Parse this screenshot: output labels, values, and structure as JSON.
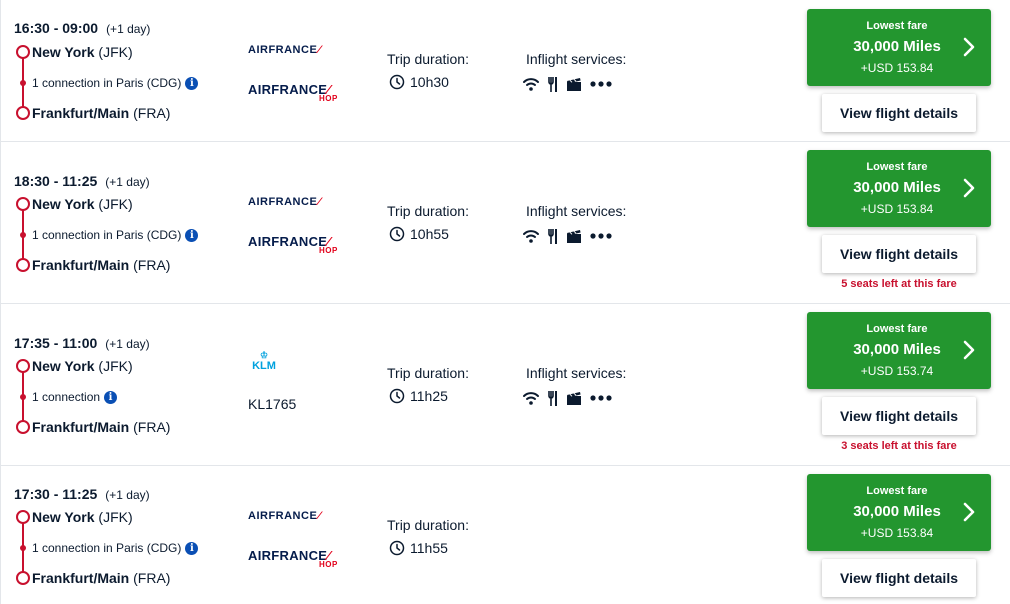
{
  "flights": [
    {
      "times": "16:30 - 09:00",
      "plus_day": "(+1 day)",
      "origin_city": "New York",
      "origin_code": "(JFK)",
      "connection": "1 connection in Paris (CDG)",
      "dest_city": "Frankfurt/Main",
      "dest_code": "(FRA)",
      "airline_primary": "AIRFRANCE",
      "airline_secondary": "AIRFRANCE",
      "airline_secondary_sub": "HOP",
      "duration_label": "Trip duration:",
      "duration": "10h30",
      "services_label": "Inflight services:",
      "fare_label": "Lowest fare",
      "fare_miles": "30,000 Miles",
      "fare_usd": "+USD 153.84",
      "details_label": "View flight details"
    },
    {
      "times": "18:30 - 11:25",
      "plus_day": "(+1 day)",
      "origin_city": "New York",
      "origin_code": "(JFK)",
      "connection": "1 connection in Paris (CDG)",
      "dest_city": "Frankfurt/Main",
      "dest_code": "(FRA)",
      "airline_primary": "AIRFRANCE",
      "airline_secondary": "AIRFRANCE",
      "airline_secondary_sub": "HOP",
      "duration_label": "Trip duration:",
      "duration": "10h55",
      "services_label": "Inflight services:",
      "fare_label": "Lowest fare",
      "fare_miles": "30,000 Miles",
      "fare_usd": "+USD 153.84",
      "details_label": "View flight details",
      "seats_left": "5 seats left at this fare"
    },
    {
      "times": "17:35 - 11:00",
      "plus_day": "(+1 day)",
      "origin_city": "New York",
      "origin_code": "(JFK)",
      "connection": "1 connection",
      "dest_city": "Frankfurt/Main",
      "dest_code": "(FRA)",
      "airline_primary": "KLM",
      "flight_number": "KL1765",
      "duration_label": "Trip duration:",
      "duration": "11h25",
      "services_label": "Inflight services:",
      "fare_label": "Lowest fare",
      "fare_miles": "30,000 Miles",
      "fare_usd": "+USD 153.74",
      "details_label": "View flight details",
      "seats_left": "3 seats left at this fare"
    },
    {
      "times": "17:30 - 11:25",
      "plus_day": "(+1 day)",
      "origin_city": "New York",
      "origin_code": "(JFK)",
      "connection": "1 connection in Paris (CDG)",
      "dest_city": "Frankfurt/Main",
      "dest_code": "(FRA)",
      "airline_primary": "AIRFRANCE",
      "airline_secondary": "AIRFRANCE",
      "airline_secondary_sub": "HOP",
      "duration_label": "Trip duration:",
      "duration": "11h55",
      "fare_label": "Lowest fare",
      "fare_miles": "30,000 Miles",
      "fare_usd": "+USD 153.84",
      "details_label": "View flight details"
    }
  ],
  "icons": {
    "info": "info-icon",
    "clock": "clock-icon",
    "wifi": "wifi-icon",
    "meal": "meal-icon",
    "entertainment": "clapperboard-icon",
    "more": "more-icon",
    "chevron": "chevron-right-icon"
  },
  "colors": {
    "fare_button": "#23962f",
    "route_accent": "#c8102e",
    "seats_warning": "#c8102e",
    "info_icon": "#0a4fb4",
    "klm_blue": "#00a1de",
    "airfrance_navy": "#051c4b",
    "airfrance_red": "#e2001a"
  }
}
